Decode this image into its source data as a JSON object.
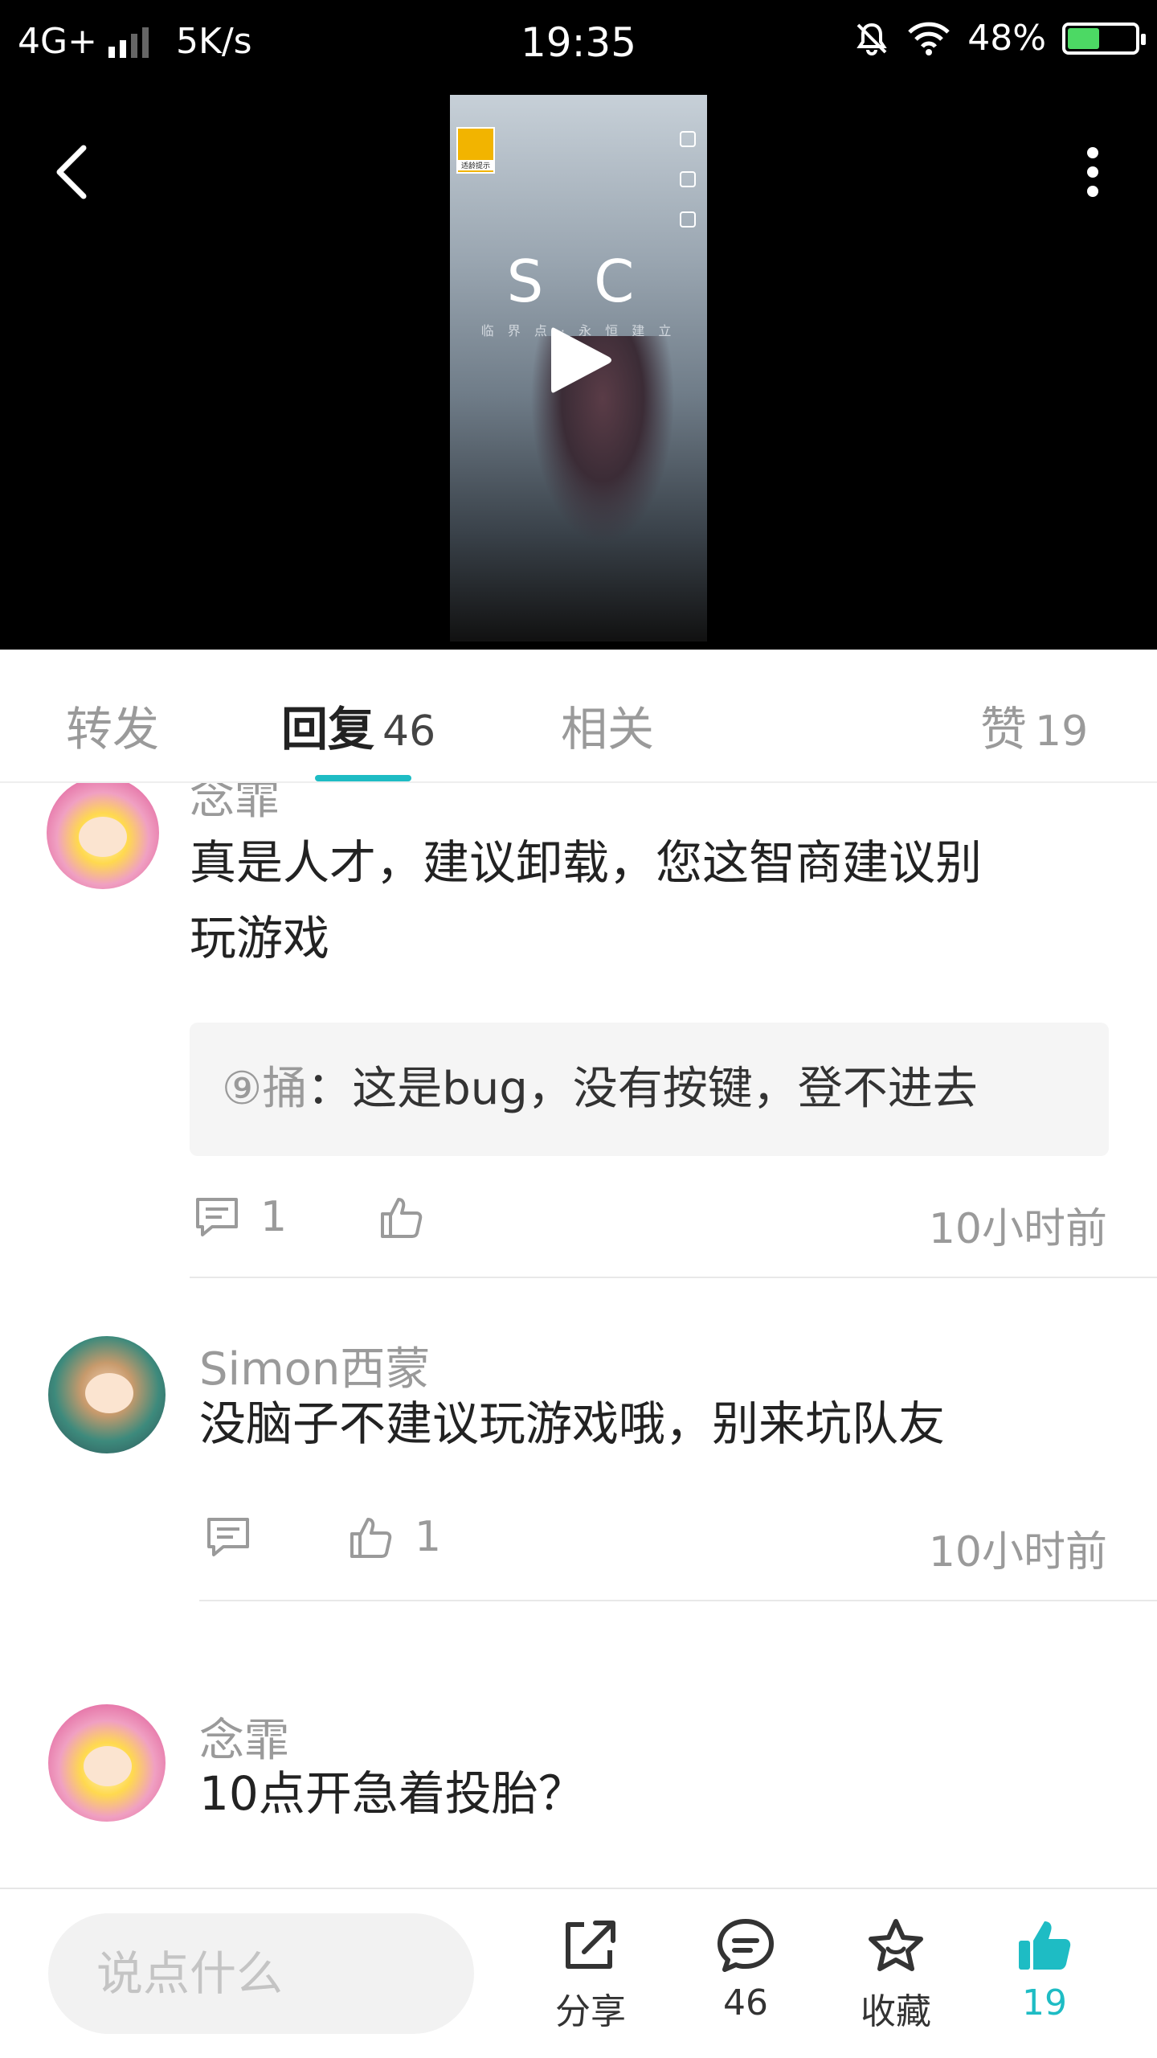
{
  "status_bar": {
    "network": "4G+",
    "speed": "5K/s",
    "time": "19:35",
    "battery": "48%"
  },
  "video": {
    "logo": "S C",
    "subtitle": "临 界 点 · 永 恒 建 立"
  },
  "tabs": [
    {
      "label": "转发",
      "count": ""
    },
    {
      "label": "回复",
      "count": "46"
    },
    {
      "label": "相关",
      "count": ""
    },
    {
      "label": "赞",
      "count": "19"
    }
  ],
  "comments": [
    {
      "username": "念霏",
      "text": [
        "真是人才，建议卸载，您这智商建议别",
        "玩游戏"
      ],
      "quote_author": "⑨捅",
      "quote_sep": "：",
      "quote_text": "这是bug，没有按键，登不进去",
      "reply_count": "1",
      "like_count": "",
      "time": "10小时前"
    },
    {
      "username": "Simon西蒙",
      "text": [
        "没脑子不建议玩游戏哦，别来坑队友"
      ],
      "reply_count": "",
      "like_count": "1",
      "time": "10小时前"
    },
    {
      "username": "念霏",
      "text": [
        "10点开急着投胎？"
      ]
    }
  ],
  "bottom_bar": {
    "placeholder": "说点什么",
    "share_label": "分享",
    "comment_count": "46",
    "favorite_label": "收藏",
    "like_count": "19"
  },
  "colors": {
    "accent": "#1ebcc4",
    "muted": "#9a9a9a"
  }
}
